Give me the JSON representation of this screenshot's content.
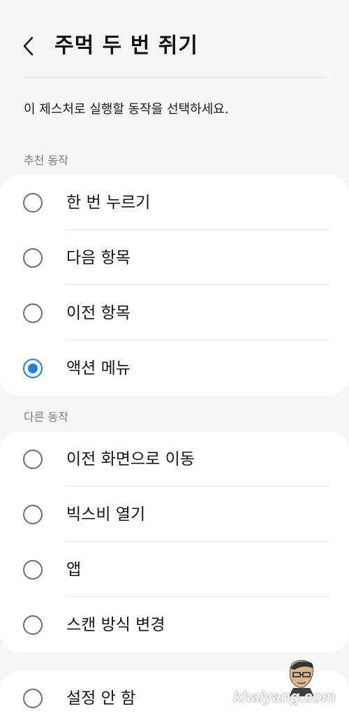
{
  "header": {
    "back_icon": "chevron-left-icon",
    "title": "주먹 두 번 쥐기"
  },
  "description": "이 제스처로 실행할 동작을 선택하세요.",
  "sections": [
    {
      "title": "추천 동작",
      "options": [
        {
          "label": "한 번 누르기",
          "selected": false
        },
        {
          "label": "다음 항목",
          "selected": false
        },
        {
          "label": "이전 항목",
          "selected": false
        },
        {
          "label": "액션 메뉴",
          "selected": true
        }
      ]
    },
    {
      "title": "다른 동작",
      "options": [
        {
          "label": "이전 화면으로 이동",
          "selected": false
        },
        {
          "label": "빅스비 열기",
          "selected": false
        },
        {
          "label": "앱",
          "selected": false
        },
        {
          "label": "스캔 방식 변경",
          "selected": false
        }
      ]
    }
  ],
  "none_option": {
    "label": "설정 안 함",
    "selected": false
  },
  "colors": {
    "accent": "#1d7fe3",
    "background": "#f6f6f6",
    "card": "#ffffff"
  },
  "watermark": {
    "text": "khaiyang.com",
    "icon": "cartoon-avatar-icon"
  }
}
